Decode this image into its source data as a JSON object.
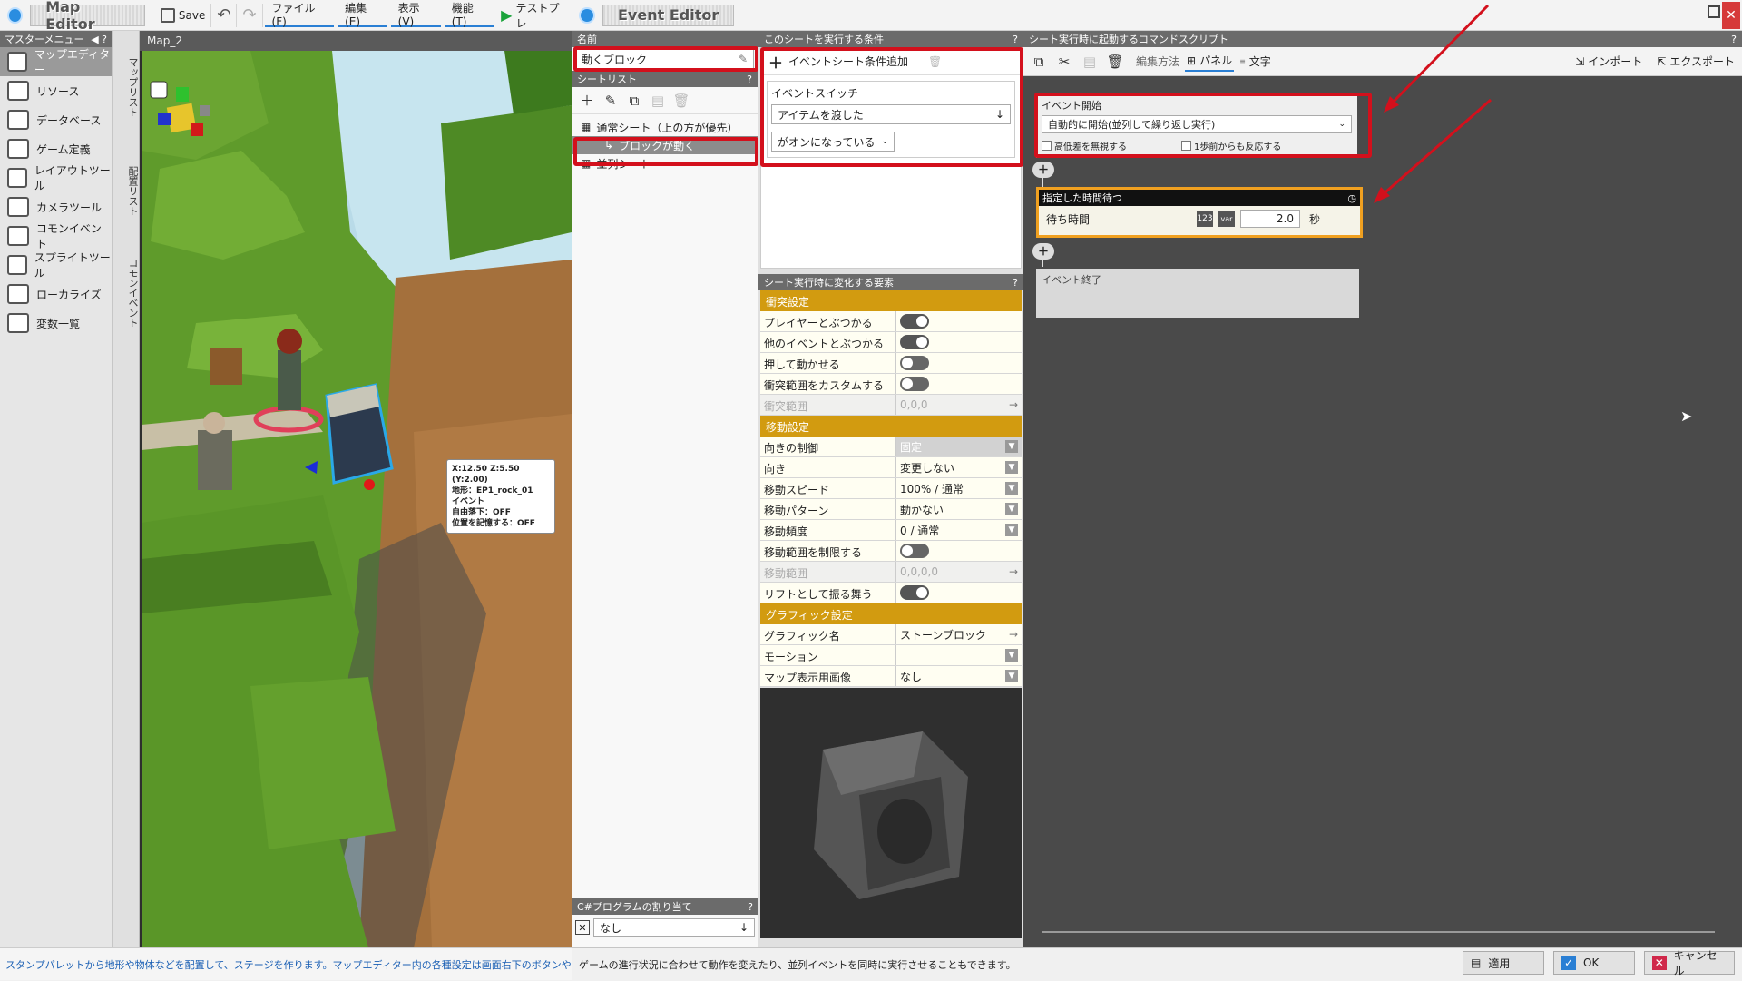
{
  "map_editor": {
    "title": "Map Editor",
    "toolbar": {
      "save_label": "Save",
      "menus": [
        "ファイル(F)",
        "編集(E)",
        "表示(V)",
        "機能(T)"
      ],
      "test_play_label": "テストプレ"
    },
    "master_menu": {
      "header": "マスターメニュー",
      "items": [
        {
          "label": "マップエディター",
          "icon": "map-editor-icon"
        },
        {
          "label": "リソース",
          "icon": "resource-icon"
        },
        {
          "label": "データベース",
          "icon": "database-icon"
        },
        {
          "label": "ゲーム定義",
          "icon": "game-definition-icon"
        },
        {
          "label": "レイアウトツール",
          "icon": "layout-tool-icon"
        },
        {
          "label": "カメラツール",
          "icon": "camera-tool-icon"
        },
        {
          "label": "コモンイベント",
          "icon": "common-event-icon"
        },
        {
          "label": "スプライトツール",
          "icon": "sprite-tool-icon"
        },
        {
          "label": "ローカライズ",
          "icon": "localize-icon"
        },
        {
          "label": "変数一覧",
          "icon": "variables-list-icon"
        }
      ]
    },
    "vertical_tabs": [
      "マップリスト",
      "配置リスト",
      "コモンイベント"
    ],
    "map_tab": "Map_2",
    "object_tooltip": [
      "X:12.50 Z:5.50 (Y:2.00)",
      "地形：EP1_rock_01",
      "イベント",
      "自由落下：OFF",
      "位置を記憶する：OFF"
    ],
    "status_text": "スタンプパレットから地形や物体などを配置して、ステージを作ります。マップエディター内の各種設定は画面右下のボタンや、"
  },
  "event_editor": {
    "title": "Event Editor",
    "name_section": {
      "header": "名前",
      "value": "動くブロック"
    },
    "sheet_list": {
      "header": "シートリスト",
      "items": [
        {
          "label": "通常シート（上の方が優先）",
          "level": 0
        },
        {
          "label": "ブロックが動く",
          "level": 1,
          "selected": true
        },
        {
          "label": "並列シート",
          "level": 0
        }
      ]
    },
    "csharp": {
      "header": "C#プログラムの割り当て",
      "value": "なし"
    },
    "conditions": {
      "header": "このシートを実行する条件",
      "add_label": "イベントシート条件追加",
      "switch_label": "イベントスイッチ",
      "switch_value": "アイテムを渡した",
      "state_value": "がオンになっている"
    },
    "changes": {
      "header": "シート実行時に変化する要素",
      "categories": [
        {
          "title": "衝突設定",
          "rows": [
            {
              "key": "プレイヤーとぶつかる",
              "type": "toggle",
              "on": true
            },
            {
              "key": "他のイベントとぶつかる",
              "type": "toggle",
              "on": true
            },
            {
              "key": "押して動かせる",
              "type": "toggle",
              "on": false
            },
            {
              "key": "衝突範囲をカスタムする",
              "type": "toggle",
              "on": false
            },
            {
              "key": "衝突範囲",
              "type": "arrow",
              "value": "0,0,0",
              "disabled": true
            }
          ]
        },
        {
          "title": "移動設定",
          "rows": [
            {
              "key": "向きの制御",
              "type": "dropdown",
              "value": "固定",
              "grey": true
            },
            {
              "key": "向き",
              "type": "dropdown",
              "value": "変更しない"
            },
            {
              "key": "移動スピード",
              "type": "dropdown",
              "value": "100% / 通常"
            },
            {
              "key": "移動パターン",
              "type": "dropdown",
              "value": "動かない"
            },
            {
              "key": "移動頻度",
              "type": "dropdown",
              "value": "0 / 通常"
            },
            {
              "key": "移動範囲を制限する",
              "type": "toggle",
              "on": false
            },
            {
              "key": "移動範囲",
              "type": "arrow",
              "value": "0,0,0,0",
              "disabled": true
            },
            {
              "key": "リフトとして振る舞う",
              "type": "toggle",
              "on": true
            }
          ]
        },
        {
          "title": "グラフィック設定",
          "rows": [
            {
              "key": "グラフィック名",
              "type": "arrow",
              "value": "ストーンブロック"
            },
            {
              "key": "モーション",
              "type": "dropdown",
              "value": ""
            },
            {
              "key": "マップ表示用画像",
              "type": "dropdown",
              "value": "なし"
            }
          ]
        }
      ]
    },
    "script": {
      "header": "シート実行時に起動するコマンドスクリプト",
      "toolbar": {
        "edit_method": "編集方法",
        "panel": "パネル",
        "text": "文字",
        "import": "インポート",
        "export": "エクスポート"
      },
      "event_start": {
        "title": "イベント開始",
        "mode": "自動的に開始(並列して繰り返し実行)",
        "ignore_height": "高低差を無視する",
        "react_one_step": "1歩前からも反応する"
      },
      "wait": {
        "title": "指定した時間待つ",
        "label": "待ち時間",
        "value": "2.0",
        "unit": "秒"
      },
      "event_end": "イベント終了"
    },
    "status_text": "ゲームの進行状況に合わせて動作を変えたり、並列イベントを同時に実行させることもできます。",
    "buttons": {
      "apply": "適用",
      "ok": "OK",
      "cancel": "キャンセル"
    }
  },
  "colors": {
    "highlight_red": "#d3101c",
    "category_gold": "#d29b10",
    "selection_orange": "#f0a020"
  }
}
